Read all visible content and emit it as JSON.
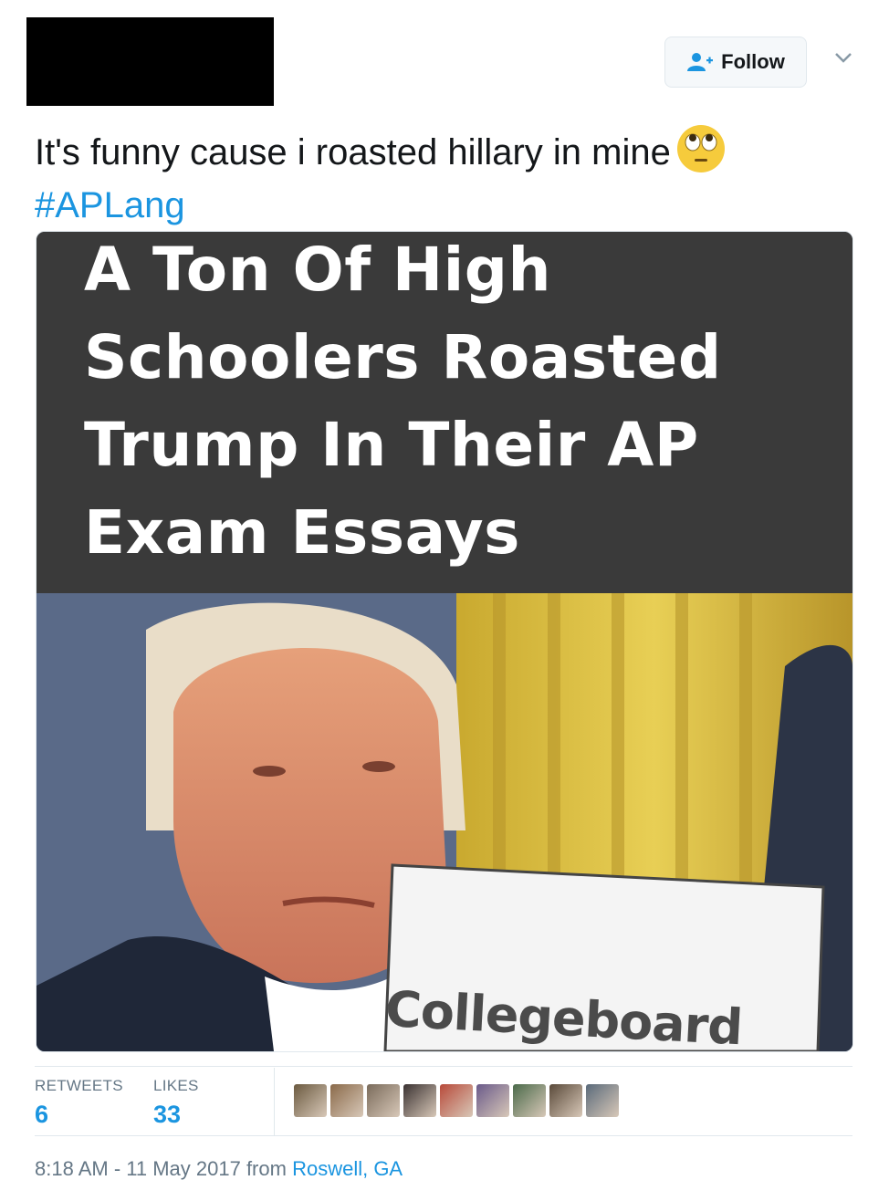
{
  "header": {
    "follow_label": "Follow",
    "follow_icon": "add-user-icon",
    "menu_icon": "chevron-down-icon"
  },
  "tweet": {
    "text": "It's funny cause i roasted hillary in mine",
    "emoji": "face-with-rolling-eyes",
    "hashtag": "#APLang"
  },
  "media": {
    "headline": "A Ton Of High Schoolers Roasted Trump In Their AP Exam Essays",
    "card_text": "Collegeboard"
  },
  "stats": {
    "retweets_label": "RETWEETS",
    "retweets_value": "6",
    "likes_label": "LIKES",
    "likes_value": "33",
    "liker_avatar_colors": [
      "#6b5a40",
      "#8a6a4a",
      "#7a6b5b",
      "#3a3232",
      "#b84a3a",
      "#6a5a8a",
      "#4a6a4a",
      "#5a4a3a",
      "#5a6a7a"
    ]
  },
  "meta": {
    "time": "8:18 AM - 11 May 2017 from",
    "location": "Roswell, GA"
  },
  "colors": {
    "link": "#1b95e0",
    "secondary": "#657786",
    "border": "#e1e8ed"
  }
}
